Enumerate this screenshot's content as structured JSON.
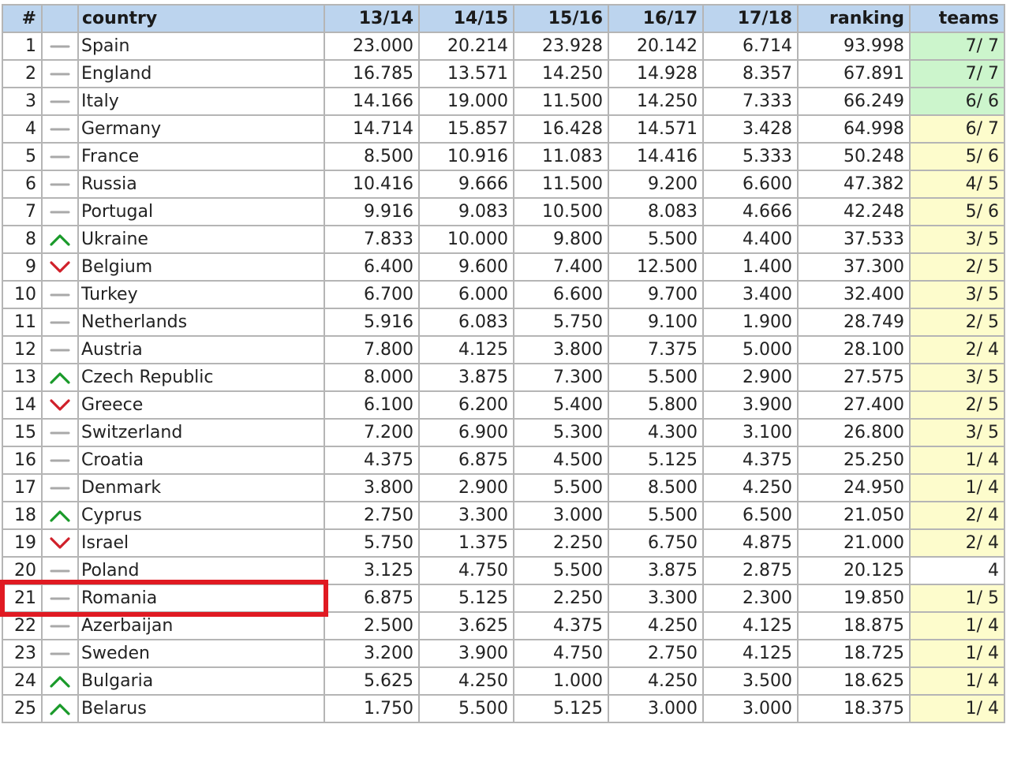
{
  "columns": [
    "#",
    "",
    "country",
    "13/14",
    "14/15",
    "15/16",
    "16/17",
    "17/18",
    "ranking",
    "teams"
  ],
  "colors": {
    "header_bg": "#bcd4ee",
    "teams_green": "#ccf5cc",
    "teams_yellow": "#fdfccc",
    "trend_up": "#1a9a2a",
    "trend_down": "#d0202a",
    "trend_same": "#a9a9a9",
    "highlight_box": "#e01a22"
  },
  "highlighted_rank": "21",
  "rows": [
    {
      "rank": "1",
      "trend": "same",
      "country": "Spain",
      "s1314": "23.000",
      "s1415": "20.214",
      "s1516": "23.928",
      "s1617": "20.142",
      "s1718": "6.714",
      "ranking": "93.998",
      "teams": "7/ 7",
      "teams_color": "green"
    },
    {
      "rank": "2",
      "trend": "same",
      "country": "England",
      "s1314": "16.785",
      "s1415": "13.571",
      "s1516": "14.250",
      "s1617": "14.928",
      "s1718": "8.357",
      "ranking": "67.891",
      "teams": "7/ 7",
      "teams_color": "green"
    },
    {
      "rank": "3",
      "trend": "same",
      "country": "Italy",
      "s1314": "14.166",
      "s1415": "19.000",
      "s1516": "11.500",
      "s1617": "14.250",
      "s1718": "7.333",
      "ranking": "66.249",
      "teams": "6/ 6",
      "teams_color": "green"
    },
    {
      "rank": "4",
      "trend": "same",
      "country": "Germany",
      "s1314": "14.714",
      "s1415": "15.857",
      "s1516": "16.428",
      "s1617": "14.571",
      "s1718": "3.428",
      "ranking": "64.998",
      "teams": "6/ 7",
      "teams_color": "yellow"
    },
    {
      "rank": "5",
      "trend": "same",
      "country": "France",
      "s1314": "8.500",
      "s1415": "10.916",
      "s1516": "11.083",
      "s1617": "14.416",
      "s1718": "5.333",
      "ranking": "50.248",
      "teams": "5/ 6",
      "teams_color": "yellow"
    },
    {
      "rank": "6",
      "trend": "same",
      "country": "Russia",
      "s1314": "10.416",
      "s1415": "9.666",
      "s1516": "11.500",
      "s1617": "9.200",
      "s1718": "6.600",
      "ranking": "47.382",
      "teams": "4/ 5",
      "teams_color": "yellow"
    },
    {
      "rank": "7",
      "trend": "same",
      "country": "Portugal",
      "s1314": "9.916",
      "s1415": "9.083",
      "s1516": "10.500",
      "s1617": "8.083",
      "s1718": "4.666",
      "ranking": "42.248",
      "teams": "5/ 6",
      "teams_color": "yellow"
    },
    {
      "rank": "8",
      "trend": "up",
      "country": "Ukraine",
      "s1314": "7.833",
      "s1415": "10.000",
      "s1516": "9.800",
      "s1617": "5.500",
      "s1718": "4.400",
      "ranking": "37.533",
      "teams": "3/ 5",
      "teams_color": "yellow"
    },
    {
      "rank": "9",
      "trend": "down",
      "country": "Belgium",
      "s1314": "6.400",
      "s1415": "9.600",
      "s1516": "7.400",
      "s1617": "12.500",
      "s1718": "1.400",
      "ranking": "37.300",
      "teams": "2/ 5",
      "teams_color": "yellow"
    },
    {
      "rank": "10",
      "trend": "same",
      "country": "Turkey",
      "s1314": "6.700",
      "s1415": "6.000",
      "s1516": "6.600",
      "s1617": "9.700",
      "s1718": "3.400",
      "ranking": "32.400",
      "teams": "3/ 5",
      "teams_color": "yellow"
    },
    {
      "rank": "11",
      "trend": "same",
      "country": "Netherlands",
      "s1314": "5.916",
      "s1415": "6.083",
      "s1516": "5.750",
      "s1617": "9.100",
      "s1718": "1.900",
      "ranking": "28.749",
      "teams": "2/ 5",
      "teams_color": "yellow"
    },
    {
      "rank": "12",
      "trend": "same",
      "country": "Austria",
      "s1314": "7.800",
      "s1415": "4.125",
      "s1516": "3.800",
      "s1617": "7.375",
      "s1718": "5.000",
      "ranking": "28.100",
      "teams": "2/ 4",
      "teams_color": "yellow"
    },
    {
      "rank": "13",
      "trend": "up",
      "country": "Czech Republic",
      "s1314": "8.000",
      "s1415": "3.875",
      "s1516": "7.300",
      "s1617": "5.500",
      "s1718": "2.900",
      "ranking": "27.575",
      "teams": "3/ 5",
      "teams_color": "yellow"
    },
    {
      "rank": "14",
      "trend": "down",
      "country": "Greece",
      "s1314": "6.100",
      "s1415": "6.200",
      "s1516": "5.400",
      "s1617": "5.800",
      "s1718": "3.900",
      "ranking": "27.400",
      "teams": "2/ 5",
      "teams_color": "yellow"
    },
    {
      "rank": "15",
      "trend": "same",
      "country": "Switzerland",
      "s1314": "7.200",
      "s1415": "6.900",
      "s1516": "5.300",
      "s1617": "4.300",
      "s1718": "3.100",
      "ranking": "26.800",
      "teams": "3/ 5",
      "teams_color": "yellow"
    },
    {
      "rank": "16",
      "trend": "same",
      "country": "Croatia",
      "s1314": "4.375",
      "s1415": "6.875",
      "s1516": "4.500",
      "s1617": "5.125",
      "s1718": "4.375",
      "ranking": "25.250",
      "teams": "1/ 4",
      "teams_color": "yellow"
    },
    {
      "rank": "17",
      "trend": "same",
      "country": "Denmark",
      "s1314": "3.800",
      "s1415": "2.900",
      "s1516": "5.500",
      "s1617": "8.500",
      "s1718": "4.250",
      "ranking": "24.950",
      "teams": "1/ 4",
      "teams_color": "yellow"
    },
    {
      "rank": "18",
      "trend": "up",
      "country": "Cyprus",
      "s1314": "2.750",
      "s1415": "3.300",
      "s1516": "3.000",
      "s1617": "5.500",
      "s1718": "6.500",
      "ranking": "21.050",
      "teams": "2/ 4",
      "teams_color": "yellow"
    },
    {
      "rank": "19",
      "trend": "down",
      "country": "Israel",
      "s1314": "5.750",
      "s1415": "1.375",
      "s1516": "2.250",
      "s1617": "6.750",
      "s1718": "4.875",
      "ranking": "21.000",
      "teams": "2/ 4",
      "teams_color": "yellow"
    },
    {
      "rank": "20",
      "trend": "same",
      "country": "Poland",
      "s1314": "3.125",
      "s1415": "4.750",
      "s1516": "5.500",
      "s1617": "3.875",
      "s1718": "2.875",
      "ranking": "20.125",
      "teams": "4",
      "teams_color": "white"
    },
    {
      "rank": "21",
      "trend": "same",
      "country": "Romania",
      "s1314": "6.875",
      "s1415": "5.125",
      "s1516": "2.250",
      "s1617": "3.300",
      "s1718": "2.300",
      "ranking": "19.850",
      "teams": "1/ 5",
      "teams_color": "yellow"
    },
    {
      "rank": "22",
      "trend": "same",
      "country": "Azerbaijan",
      "s1314": "2.500",
      "s1415": "3.625",
      "s1516": "4.375",
      "s1617": "4.250",
      "s1718": "4.125",
      "ranking": "18.875",
      "teams": "1/ 4",
      "teams_color": "yellow"
    },
    {
      "rank": "23",
      "trend": "same",
      "country": "Sweden",
      "s1314": "3.200",
      "s1415": "3.900",
      "s1516": "4.750",
      "s1617": "2.750",
      "s1718": "4.125",
      "ranking": "18.725",
      "teams": "1/ 4",
      "teams_color": "yellow"
    },
    {
      "rank": "24",
      "trend": "up",
      "country": "Bulgaria",
      "s1314": "5.625",
      "s1415": "4.250",
      "s1516": "1.000",
      "s1617": "4.250",
      "s1718": "3.500",
      "ranking": "18.625",
      "teams": "1/ 4",
      "teams_color": "yellow"
    },
    {
      "rank": "25",
      "trend": "up",
      "country": "Belarus",
      "s1314": "1.750",
      "s1415": "5.500",
      "s1516": "5.125",
      "s1617": "3.000",
      "s1718": "3.000",
      "ranking": "18.375",
      "teams": "1/ 4",
      "teams_color": "yellow"
    }
  ]
}
